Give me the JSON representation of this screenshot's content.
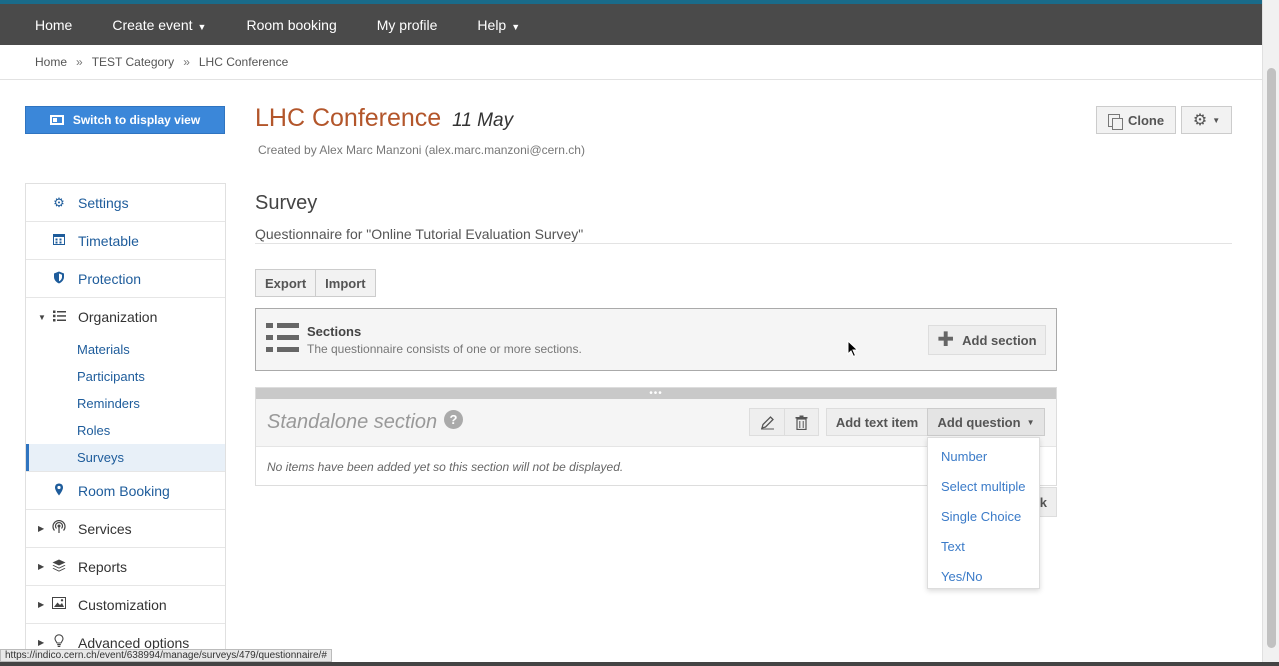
{
  "nav": {
    "items": [
      {
        "label": "Home",
        "caret": false
      },
      {
        "label": "Create event",
        "caret": true
      },
      {
        "label": "Room booking",
        "caret": false
      },
      {
        "label": "My profile",
        "caret": false
      },
      {
        "label": "Help",
        "caret": true
      }
    ]
  },
  "breadcrumb": {
    "items": [
      "Home",
      "TEST Category",
      "LHC Conference"
    ],
    "separator": "»"
  },
  "switch_view": {
    "label": "Switch to display view"
  },
  "sidebar": {
    "items": [
      {
        "label": "Settings",
        "icon": "gear-icon"
      },
      {
        "label": "Timetable",
        "icon": "calendar-icon"
      },
      {
        "label": "Protection",
        "icon": "shield-icon"
      },
      {
        "label": "Organization",
        "icon": "list-icon"
      },
      {
        "label": "Room Booking",
        "icon": "location-pin-icon"
      },
      {
        "label": "Services",
        "icon": "broadcast-icon"
      },
      {
        "label": "Reports",
        "icon": "layers-icon"
      },
      {
        "label": "Customization",
        "icon": "image-icon"
      },
      {
        "label": "Advanced options",
        "icon": "bulb-icon"
      }
    ],
    "organization_sub": [
      "Materials",
      "Participants",
      "Reminders",
      "Roles",
      "Surveys"
    ],
    "active": "Surveys"
  },
  "event": {
    "title": "LHC Conference",
    "date": "11 May",
    "created_by": "Created by Alex Marc Manzoni (alex.marc.manzoni@cern.ch)"
  },
  "actions": {
    "clone": "Clone"
  },
  "survey": {
    "title": "Survey",
    "subtitle": "Questionnaire for \"Online Tutorial Evaluation Survey\"",
    "export": "Export",
    "import": "Import"
  },
  "sections_box": {
    "heading": "Sections",
    "description": "The questionnaire consists of one or more sections.",
    "add_section": "Add section"
  },
  "standalone": {
    "title": "Standalone section",
    "add_text_item": "Add text item",
    "add_question": "Add question",
    "empty_message": "No items have been added yet so this section will not be displayed.",
    "peek_char": "k"
  },
  "question_types": [
    "Number",
    "Select multiple",
    "Single Choice",
    "Text",
    "Yes/No"
  ],
  "statusbar": {
    "url": "https://indico.cern.ch/event/638994/manage/surveys/479/questionnaire/#"
  },
  "colors": {
    "navbar": "#4a4a4a",
    "accent_blue": "#3b87d9",
    "title_orange": "#b3562b",
    "link_blue": "#1e5c9b"
  }
}
